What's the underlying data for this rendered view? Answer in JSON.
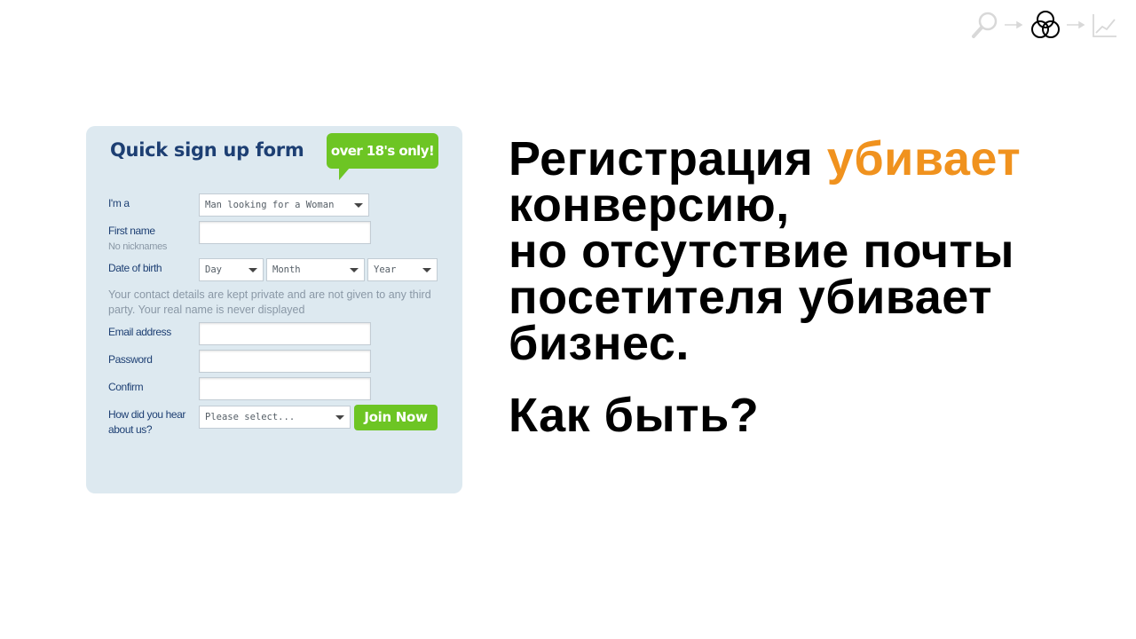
{
  "process_icons": [
    "magnifier-icon",
    "arrow-right-icon",
    "venn-circles-icon",
    "arrow-right-icon",
    "line-chart-icon"
  ],
  "form": {
    "title": "Quick sign up form",
    "badge": "over 18's only!",
    "fields": {
      "iam_label": "I'm a",
      "iam_value": "Man looking for a Woman",
      "first_name_label": "First name",
      "first_name_hint": "No nicknames",
      "dob_label": "Date of birth",
      "dob_day": "Day",
      "dob_month": "Month",
      "dob_year": "Year",
      "privacy_note": "Your contact details are kept private and are not given to any third party. Your real name is never displayed",
      "email_label": "Email address",
      "password_label": "Password",
      "confirm_label": "Confirm",
      "hear_label_1": "How did you hear",
      "hear_label_2": "about us?",
      "hear_value": "Please select...",
      "join_label": "Join Now"
    }
  },
  "headline": {
    "line1_start": "Регистрация ",
    "line1_highlight": "убивает",
    "line2": "конверсию,",
    "line3": "но отсутствие почты",
    "line4": "посетителя убивает",
    "line5": "бизнес.",
    "question": "Как быть?"
  },
  "colors": {
    "highlight": "#f0921e",
    "form_bg": "#dde9f0",
    "brand_green": "#6dc524",
    "form_title": "#1d3f73"
  }
}
